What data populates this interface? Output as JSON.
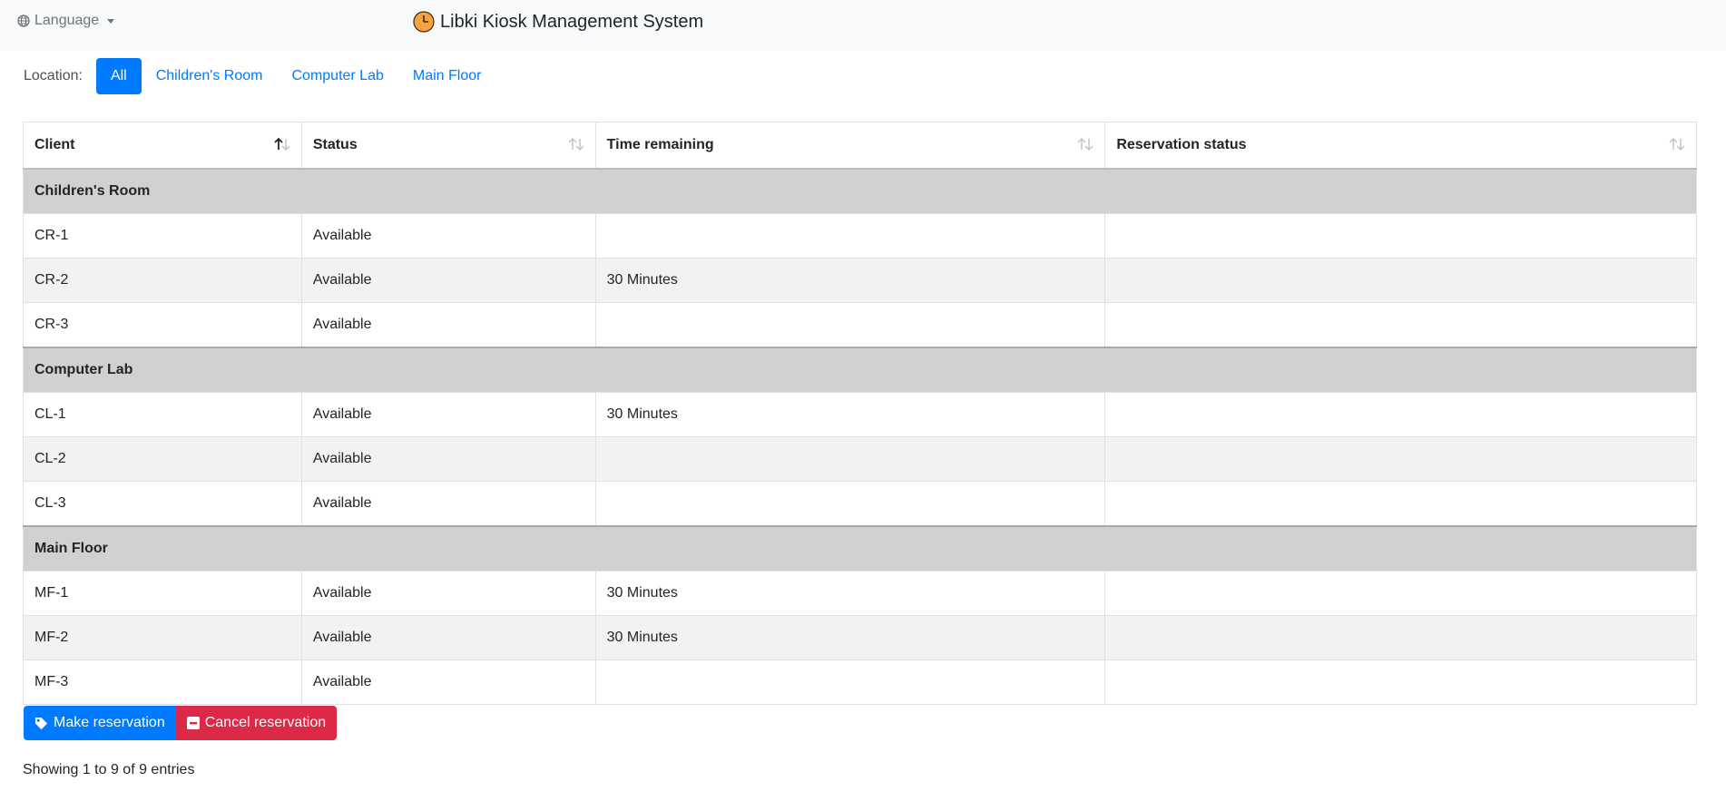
{
  "header": {
    "language_label": "Language",
    "app_title": "Libki Kiosk Management System"
  },
  "location_filter": {
    "label": "Location:",
    "options": [
      "All",
      "Children's Room",
      "Computer Lab",
      "Main Floor"
    ],
    "selected": "All"
  },
  "table": {
    "columns": [
      "Client",
      "Status",
      "Time remaining",
      "Reservation status"
    ],
    "groups": [
      {
        "name": "Children's Room",
        "rows": [
          {
            "client": "CR-1",
            "status": "Available",
            "time_remaining": "",
            "reservation_status": ""
          },
          {
            "client": "CR-2",
            "status": "Available",
            "time_remaining": "30 Minutes",
            "reservation_status": ""
          },
          {
            "client": "CR-3",
            "status": "Available",
            "time_remaining": "",
            "reservation_status": ""
          }
        ]
      },
      {
        "name": "Computer Lab",
        "rows": [
          {
            "client": "CL-1",
            "status": "Available",
            "time_remaining": "30 Minutes",
            "reservation_status": ""
          },
          {
            "client": "CL-2",
            "status": "Available",
            "time_remaining": "",
            "reservation_status": ""
          },
          {
            "client": "CL-3",
            "status": "Available",
            "time_remaining": "",
            "reservation_status": ""
          }
        ]
      },
      {
        "name": "Main Floor",
        "rows": [
          {
            "client": "MF-1",
            "status": "Available",
            "time_remaining": "30 Minutes",
            "reservation_status": ""
          },
          {
            "client": "MF-2",
            "status": "Available",
            "time_remaining": "30 Minutes",
            "reservation_status": ""
          },
          {
            "client": "MF-3",
            "status": "Available",
            "time_remaining": "",
            "reservation_status": ""
          }
        ]
      }
    ]
  },
  "actions": {
    "make_reservation": "Make reservation",
    "cancel_reservation": "Cancel reservation"
  },
  "footer": {
    "info": "Showing 1 to 9 of 9 entries"
  },
  "colors": {
    "primary": "#007bff",
    "danger": "#dc2947",
    "group_header": "#d2d1d2",
    "stripe": "#f2f2f2",
    "clock_icon": "#f4a340"
  }
}
